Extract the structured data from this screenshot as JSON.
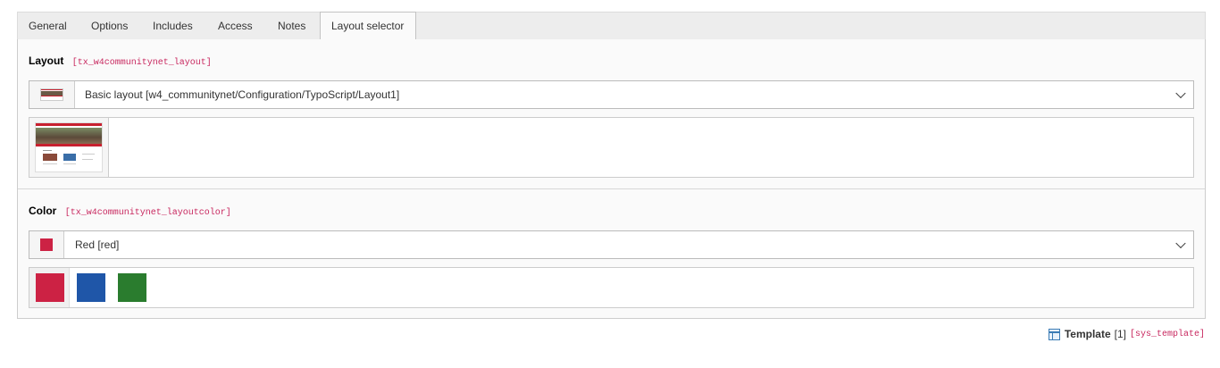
{
  "tabs": [
    {
      "label": "General"
    },
    {
      "label": "Options"
    },
    {
      "label": "Includes"
    },
    {
      "label": "Access"
    },
    {
      "label": "Notes"
    },
    {
      "label": "Layout selector",
      "active": true
    }
  ],
  "layout_field": {
    "label": "Layout",
    "code": "[tx_w4communitynet_layout]",
    "selected": "Basic layout [w4_communitynet/Configuration/TypoScript/Layout1]",
    "icon": "layout-thumbnail"
  },
  "color_field": {
    "label": "Color",
    "code": "[tx_w4communitynet_layoutcolor]",
    "selected": "Red [red]",
    "selected_color": "#cc2244",
    "options": [
      {
        "name": "red",
        "color": "#cc2244"
      },
      {
        "name": "blue",
        "color": "#1f56a8"
      },
      {
        "name": "green",
        "color": "#2a7c2e"
      }
    ]
  },
  "footer": {
    "title": "Template",
    "count": "[1]",
    "table": "[sys_template]"
  }
}
